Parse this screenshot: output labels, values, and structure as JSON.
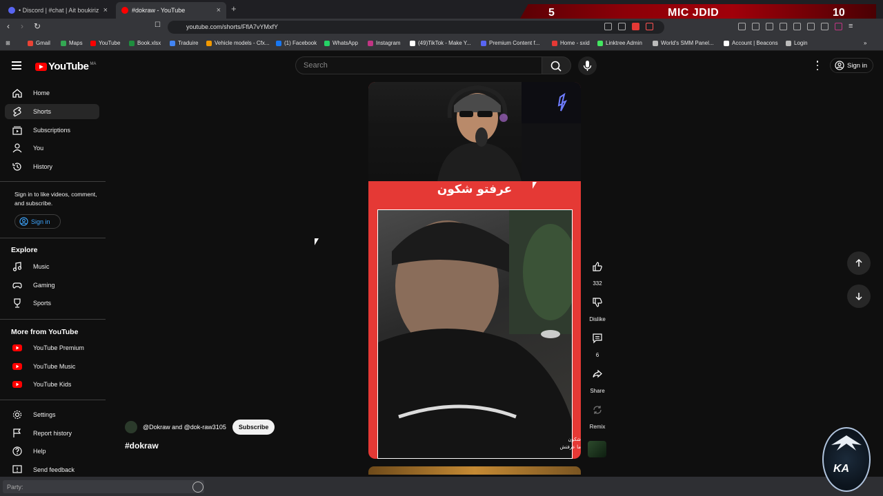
{
  "browser": {
    "tabs": [
      {
        "title": "• Discord | #chat | Ait boukiriz"
      },
      {
        "title": "#dokraw - YouTube"
      }
    ],
    "new_tab": "+",
    "url": "youtube.com/shorts/FflA7vYMxfY",
    "bookmarks": [
      {
        "label": "Gmail",
        "color": "#ea4335"
      },
      {
        "label": "Maps",
        "color": "#34a853"
      },
      {
        "label": "YouTube",
        "color": "#ff0000"
      },
      {
        "label": "Book.xlsx",
        "color": "#1e8e3e"
      },
      {
        "label": "Traduire",
        "color": "#4285f4"
      },
      {
        "label": "Vehicle models - Cfx...",
        "color": "#f29900"
      },
      {
        "label": "(1) Facebook",
        "color": "#1877f2"
      },
      {
        "label": "WhatsApp",
        "color": "#25d366"
      },
      {
        "label": "Instagram",
        "color": "#c13584"
      },
      {
        "label": "(49)TikTok - Make Y...",
        "color": "#ffffff"
      },
      {
        "label": "Premium Content f...",
        "color": "#5865f2"
      },
      {
        "label": "Home - sxid",
        "color": "#e53935"
      },
      {
        "label": "Linktree Admin",
        "color": "#43e660"
      },
      {
        "label": "World's SMM Panel...",
        "color": "#bbbbbb"
      },
      {
        "label": "Account | Beacons",
        "color": "#ffffff"
      },
      {
        "label": "Login",
        "color": "#bbbbbb"
      }
    ]
  },
  "stream_overlay": {
    "left_number": "5",
    "title": "MIC JDID",
    "right_number": "10"
  },
  "header": {
    "logo": "YouTube",
    "country": "MA",
    "search_placeholder": "Search",
    "sign_in": "Sign in"
  },
  "sidebar": {
    "main": [
      {
        "label": "Home",
        "icon": "home-icon"
      },
      {
        "label": "Shorts",
        "icon": "shorts-icon",
        "active": true
      },
      {
        "label": "Subscriptions",
        "icon": "subscriptions-icon"
      },
      {
        "label": "You",
        "icon": "you-icon"
      },
      {
        "label": "History",
        "icon": "history-icon"
      }
    ],
    "signin_note": "Sign in to like videos, comment, and subscribe.",
    "signin_button": "Sign in",
    "explore_heading": "Explore",
    "explore": [
      {
        "label": "Music",
        "icon": "music-icon"
      },
      {
        "label": "Gaming",
        "icon": "gaming-icon"
      },
      {
        "label": "Sports",
        "icon": "sports-icon"
      }
    ],
    "more_heading": "More from YouTube",
    "more": [
      {
        "label": "YouTube Premium"
      },
      {
        "label": "YouTube Music"
      },
      {
        "label": "YouTube Kids"
      }
    ],
    "footer": [
      {
        "label": "Settings",
        "icon": "settings-icon"
      },
      {
        "label": "Report history",
        "icon": "flag-icon"
      },
      {
        "label": "Help",
        "icon": "help-icon"
      },
      {
        "label": "Send feedback",
        "icon": "feedback-icon"
      }
    ]
  },
  "short": {
    "caption": "عرفتو شكون",
    "overlay_line1": "شكون",
    "overlay_line2": "ما عرفتش",
    "channel": "@Dokraw and @dok-raw3105",
    "subscribe": "Subscribe",
    "hashtag": "#dokraw",
    "actions": {
      "likes": "332",
      "dislike": "Dislike",
      "comments": "6",
      "share": "Share",
      "remix": "Remix"
    }
  },
  "bottom_bar": {
    "party_placeholder": "Party:"
  },
  "watermark": {
    "text": "KA"
  },
  "colors": {
    "bg": "#0f0f0f",
    "accent_red": "#ff0000",
    "short_frame": "#e53935",
    "link_blue": "#3ea6ff"
  }
}
